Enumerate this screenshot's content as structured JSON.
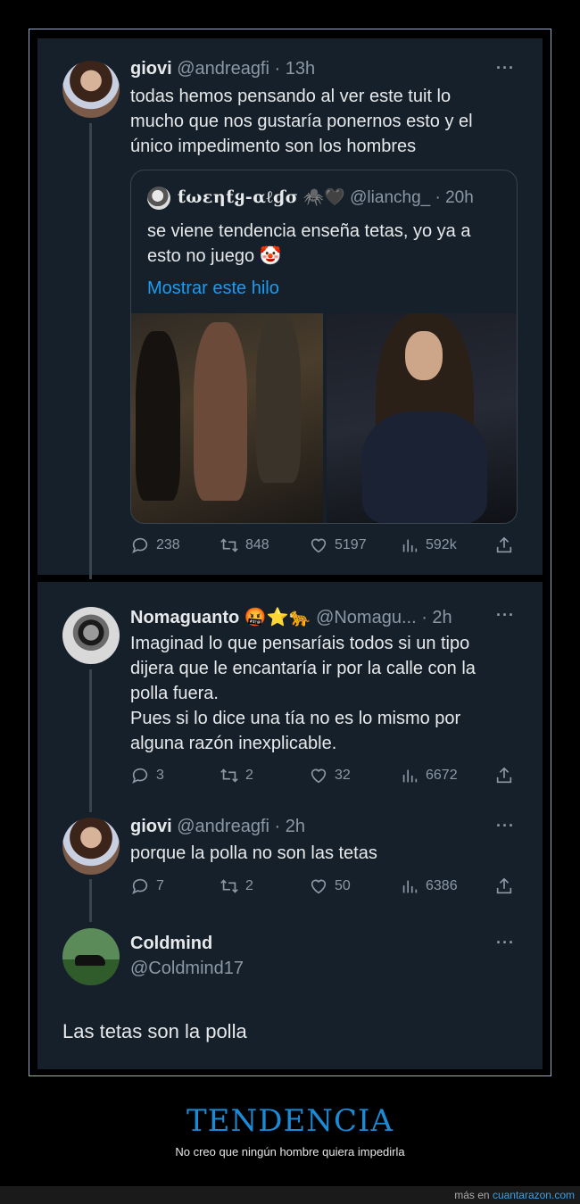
{
  "main_tweet": {
    "name": "giovi",
    "handle_time": "@andreagfi · 13h",
    "more": "···",
    "text_lines": [
      "todas hemos pensando al ver este tuit lo",
      "mucho que nos gustaría ponernos esto y el",
      "único impedimento son los hombres"
    ],
    "quote": {
      "name": "ƭωεηƭყ-αℓɠσ",
      "emoji": "🕷️🖤",
      "handle_time": "@lianchg_ · 20h",
      "text_lines": [
        "se viene tendencia enseña tetas, yo ya a",
        "esto no juego 🤡"
      ],
      "show_thread": "Mostrar este hilo"
    },
    "stats": {
      "replies": "238",
      "retweets": "848",
      "likes": "5197",
      "views": "592k"
    }
  },
  "reply1": {
    "name": "Nomaguanto",
    "emoji": "🤬⭐🐆",
    "handle_time": "@Nomagu... · 2h",
    "more": "···",
    "text_lines": [
      "Imaginad lo que pensaríais todos si un tipo",
      "dijera que le encantaría ir por la calle con la",
      "polla fuera.",
      "Pues si lo dice una tía no es lo mismo por",
      "alguna razón inexplicable."
    ],
    "stats": {
      "replies": "3",
      "retweets": "2",
      "likes": "32",
      "views": "6672"
    }
  },
  "reply2": {
    "name": "giovi",
    "handle_time": "@andreagfi · 2h",
    "more": "···",
    "text": "porque la polla no son las tetas",
    "stats": {
      "replies": "7",
      "retweets": "2",
      "likes": "50",
      "views": "6386"
    }
  },
  "reply3": {
    "name": "Coldmind",
    "handle": "@Coldmind17",
    "more": "···",
    "text": "Las tetas son la polla"
  },
  "banner": {
    "title": "TENDENCIA",
    "subtitle": "No creo que ningún hombre quiera impedirla"
  },
  "footer": {
    "prefix": "más en ",
    "site": "cuantarazon.com"
  },
  "colors": {
    "panel": "#15202b",
    "link": "#1d9bf0",
    "muted": "#8b98a5",
    "banner": "#1d8ad6"
  }
}
